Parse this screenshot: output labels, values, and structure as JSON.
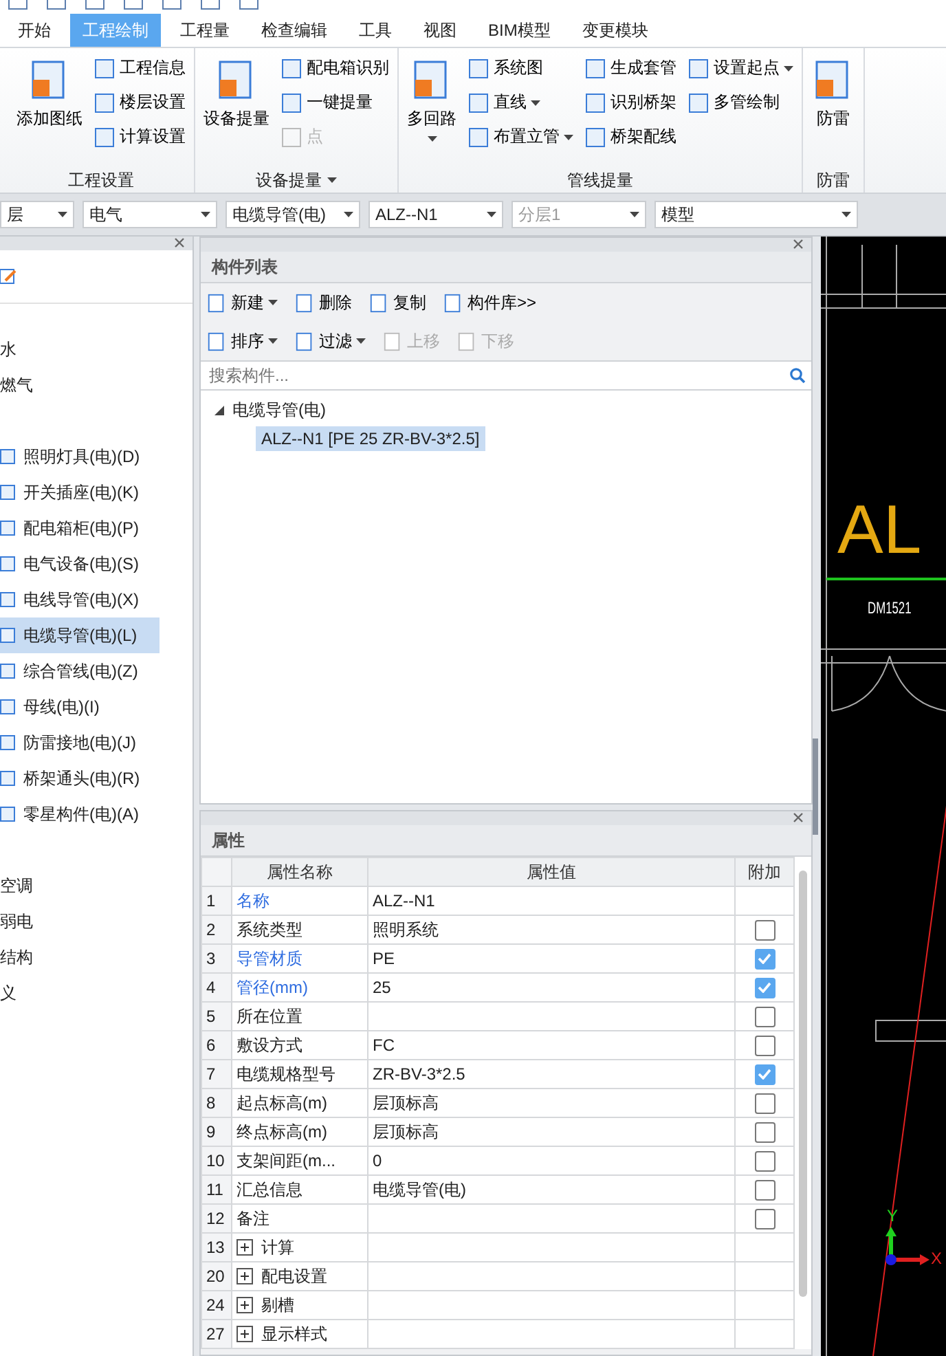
{
  "tabs": [
    {
      "label": "开始",
      "selected": false
    },
    {
      "label": "工程绘制",
      "selected": true
    },
    {
      "label": "工程量",
      "selected": false
    },
    {
      "label": "检查编辑",
      "selected": false
    },
    {
      "label": "工具",
      "selected": false
    },
    {
      "label": "视图",
      "selected": false
    },
    {
      "label": "BIM模型",
      "selected": false
    },
    {
      "label": "变更模块",
      "selected": false
    }
  ],
  "ribbon": [
    {
      "title": "工程设置",
      "dropdown": false,
      "large": [
        {
          "label": "添加图纸",
          "dropdown": false
        }
      ],
      "columns": [
        [
          {
            "label": "工程信息",
            "dropdown": false,
            "disabled": false
          },
          {
            "label": "楼层设置",
            "dropdown": false,
            "disabled": false
          },
          {
            "label": "计算设置",
            "dropdown": false,
            "disabled": false
          }
        ]
      ]
    },
    {
      "title": "设备提量",
      "dropdown": true,
      "large": [
        {
          "label": "设备提量",
          "dropdown": false
        }
      ],
      "columns": [
        [
          {
            "label": "配电箱识别",
            "dropdown": false,
            "disabled": false
          },
          {
            "label": "一键提量",
            "dropdown": false,
            "disabled": false
          },
          {
            "label": "点",
            "dropdown": false,
            "disabled": true
          }
        ]
      ]
    },
    {
      "title": "管线提量",
      "dropdown": false,
      "large": [
        {
          "label": "多回路",
          "dropdown": true
        }
      ],
      "columns": [
        [
          {
            "label": "系统图",
            "dropdown": false,
            "disabled": false
          },
          {
            "label": "直线",
            "dropdown": true,
            "disabled": false
          },
          {
            "label": "布置立管",
            "dropdown": true,
            "disabled": false
          }
        ],
        [
          {
            "label": "生成套管",
            "dropdown": false,
            "disabled": false
          },
          {
            "label": "识别桥架",
            "dropdown": false,
            "disabled": false
          },
          {
            "label": "桥架配线",
            "dropdown": false,
            "disabled": false
          }
        ],
        [
          {
            "label": "设置起点",
            "dropdown": true,
            "disabled": false
          },
          {
            "label": "多管绘制",
            "dropdown": false,
            "disabled": false
          }
        ]
      ]
    },
    {
      "title": "防雷",
      "dropdown": false,
      "large": [
        {
          "label": "防雷",
          "dropdown": false
        }
      ]
    }
  ],
  "selectors": [
    {
      "value": "层",
      "disabled": false
    },
    {
      "value": "电气",
      "disabled": false
    },
    {
      "value": "电缆导管(电)",
      "disabled": false
    },
    {
      "value": "ALZ--N1",
      "disabled": false
    },
    {
      "value": "分层1",
      "disabled": true
    },
    {
      "value": "模型",
      "disabled": false
    }
  ],
  "navigator": {
    "items": [
      {
        "label": "水",
        "kind": "group",
        "selected": false
      },
      {
        "label": "燃气",
        "kind": "group",
        "selected": false
      },
      {
        "label": "照明灯具(电)(D)",
        "kind": "item",
        "selected": false
      },
      {
        "label": "开关插座(电)(K)",
        "kind": "item",
        "selected": false
      },
      {
        "label": "配电箱柜(电)(P)",
        "kind": "item",
        "selected": false
      },
      {
        "label": "电气设备(电)(S)",
        "kind": "item",
        "selected": false
      },
      {
        "label": "电线导管(电)(X)",
        "kind": "item",
        "selected": false
      },
      {
        "label": "电缆导管(电)(L)",
        "kind": "item",
        "selected": true
      },
      {
        "label": "综合管线(电)(Z)",
        "kind": "item",
        "selected": false
      },
      {
        "label": "母线(电)(I)",
        "kind": "item",
        "selected": false
      },
      {
        "label": "防雷接地(电)(J)",
        "kind": "item",
        "selected": false
      },
      {
        "label": "桥架通头(电)(R)",
        "kind": "item",
        "selected": false
      },
      {
        "label": "零星构件(电)(A)",
        "kind": "item",
        "selected": false
      },
      {
        "label": "空调",
        "kind": "group",
        "selected": false
      },
      {
        "label": "弱电",
        "kind": "group",
        "selected": false
      },
      {
        "label": "结构",
        "kind": "group",
        "selected": false
      },
      {
        "label": "义",
        "kind": "group",
        "selected": false
      }
    ]
  },
  "component_list": {
    "title": "构件列表",
    "toolbar_rows": [
      [
        {
          "label": "新建",
          "dropdown": true,
          "disabled": false
        },
        {
          "label": "删除",
          "dropdown": false,
          "disabled": false
        },
        {
          "label": "复制",
          "dropdown": false,
          "disabled": false
        },
        {
          "label": "构件库>>",
          "dropdown": false,
          "disabled": false
        }
      ],
      [
        {
          "label": "排序",
          "dropdown": true,
          "disabled": false
        },
        {
          "label": "过滤",
          "dropdown": true,
          "disabled": false
        },
        {
          "label": "上移",
          "dropdown": false,
          "disabled": true
        },
        {
          "label": "下移",
          "dropdown": false,
          "disabled": true
        }
      ]
    ],
    "search": {
      "placeholder": "搜索构件..."
    },
    "tree": [
      {
        "label": "电缆导管(电)",
        "expanded": true,
        "children": [
          {
            "label": "ALZ--N1 [PE 25 ZR-BV-3*2.5]",
            "selected": true
          }
        ]
      }
    ]
  },
  "properties": {
    "title": "属性",
    "columns": [
      "属性名称",
      "属性值",
      "附加"
    ],
    "rows": [
      {
        "num": "1",
        "name": "名称",
        "value": "ALZ--N1",
        "kind": "plain",
        "emphasis": true
      },
      {
        "num": "2",
        "name": "系统类型",
        "value": "照明系统",
        "kind": "check",
        "checked": false,
        "emphasis": false
      },
      {
        "num": "3",
        "name": "导管材质",
        "value": "PE",
        "kind": "check",
        "checked": true,
        "emphasis": true
      },
      {
        "num": "4",
        "name": "管径(mm)",
        "value": "25",
        "kind": "check",
        "checked": true,
        "emphasis": true
      },
      {
        "num": "5",
        "name": "所在位置",
        "kind": "check",
        "checked": false,
        "emphasis": false
      },
      {
        "num": "6",
        "name": "敷设方式",
        "value": "FC",
        "kind": "check",
        "checked": false,
        "emphasis": false
      },
      {
        "num": "7",
        "name": "电缆规格型号",
        "value": "ZR-BV-3*2.5",
        "kind": "check",
        "checked": true,
        "emphasis": false
      },
      {
        "num": "8",
        "name": "起点标高(m)",
        "value": "层顶标高",
        "kind": "check",
        "checked": false,
        "emphasis": false
      },
      {
        "num": "9",
        "name": "终点标高(m)",
        "value": "层顶标高",
        "kind": "check",
        "checked": false,
        "emphasis": false
      },
      {
        "num": "10",
        "name": "支架间距(m...",
        "value": "0",
        "kind": "check",
        "checked": false,
        "emphasis": false
      },
      {
        "num": "11",
        "name": "汇总信息",
        "value": "电缆导管(电)",
        "kind": "check",
        "checked": false,
        "emphasis": false
      },
      {
        "num": "12",
        "name": "备注",
        "kind": "check",
        "checked": false,
        "emphasis": false
      },
      {
        "num": "13",
        "name": "计算",
        "kind": "group"
      },
      {
        "num": "20",
        "name": "配电设置",
        "kind": "group"
      },
      {
        "num": "24",
        "name": "剔槽",
        "kind": "group"
      },
      {
        "num": "27",
        "name": "显示样式",
        "kind": "group"
      }
    ]
  },
  "drawing": {
    "labels": [
      "AL",
      "DM1521"
    ],
    "axes": {
      "y": "Y",
      "x": "X"
    }
  }
}
